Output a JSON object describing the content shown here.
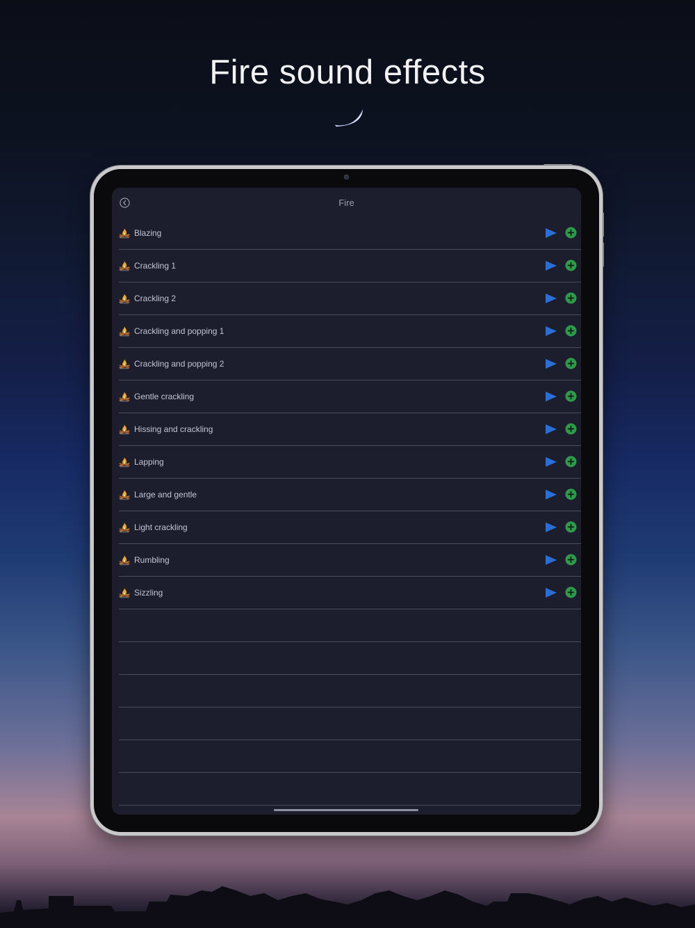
{
  "headline": "Fire sound effects",
  "colors": {
    "screen_bg": "#1d1e2d",
    "play_accent": "#2a6fd6",
    "add_accent": "#2f9a4c",
    "divider": "#4a4c5c"
  },
  "navbar": {
    "title": "Fire",
    "back_icon": "chevron-left-circle-icon"
  },
  "row_icon": "campfire-icon",
  "sounds": [
    {
      "label": "Blazing"
    },
    {
      "label": "Crackling 1"
    },
    {
      "label": "Crackling 2"
    },
    {
      "label": "Crackling and popping 1"
    },
    {
      "label": "Crackling and popping 2"
    },
    {
      "label": "Gentle crackling"
    },
    {
      "label": "Hissing and crackling"
    },
    {
      "label": "Lapping"
    },
    {
      "label": "Large and gentle"
    },
    {
      "label": "Light crackling"
    },
    {
      "label": "Rumbling"
    },
    {
      "label": "Sizzling"
    }
  ],
  "empty_rows": 6
}
